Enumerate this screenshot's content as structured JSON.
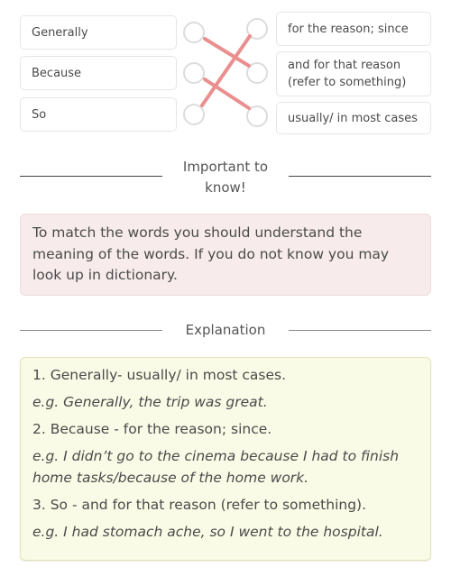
{
  "matching": {
    "left_items": [
      {
        "label": "Generally"
      },
      {
        "label": "Because"
      },
      {
        "label": "So"
      }
    ],
    "right_items": [
      {
        "label": "for the reason; since"
      },
      {
        "label": "and for that reason (refer to something)"
      },
      {
        "label": "usually/ in most cases"
      }
    ],
    "connections": [
      {
        "from": "Generally",
        "to": "and for that reason (refer to something)"
      },
      {
        "from": "Because",
        "to": "usually/ in most cases"
      },
      {
        "from": "So",
        "to": "for the reason; since"
      }
    ],
    "line_color": "#ea8f8f"
  },
  "important": {
    "title": "Important to know!",
    "title_line1": "Important to",
    "title_line2": "know!",
    "text": "To match the words you should understand the meaning of the words. If you do not know you may look up in dictionary."
  },
  "explanation": {
    "title": "Explanation",
    "items": [
      {
        "definition": "1. Generally- usually/ in most cases.",
        "example": "e.g. Generally, the trip was great."
      },
      {
        "definition": "2. Because - for the reason; since.",
        "example": "e.g. I didn’t go to the cinema because I had to finish home tasks/because of the home work."
      },
      {
        "definition": "3. So - and for that reason (refer to something).",
        "example": "e.g. I had stomach ache, so I went to the hospital."
      }
    ]
  },
  "colors": {
    "note_bg": "#f7eceb",
    "explain_bg": "#fafbe6",
    "connector": "#ea8f8f"
  }
}
